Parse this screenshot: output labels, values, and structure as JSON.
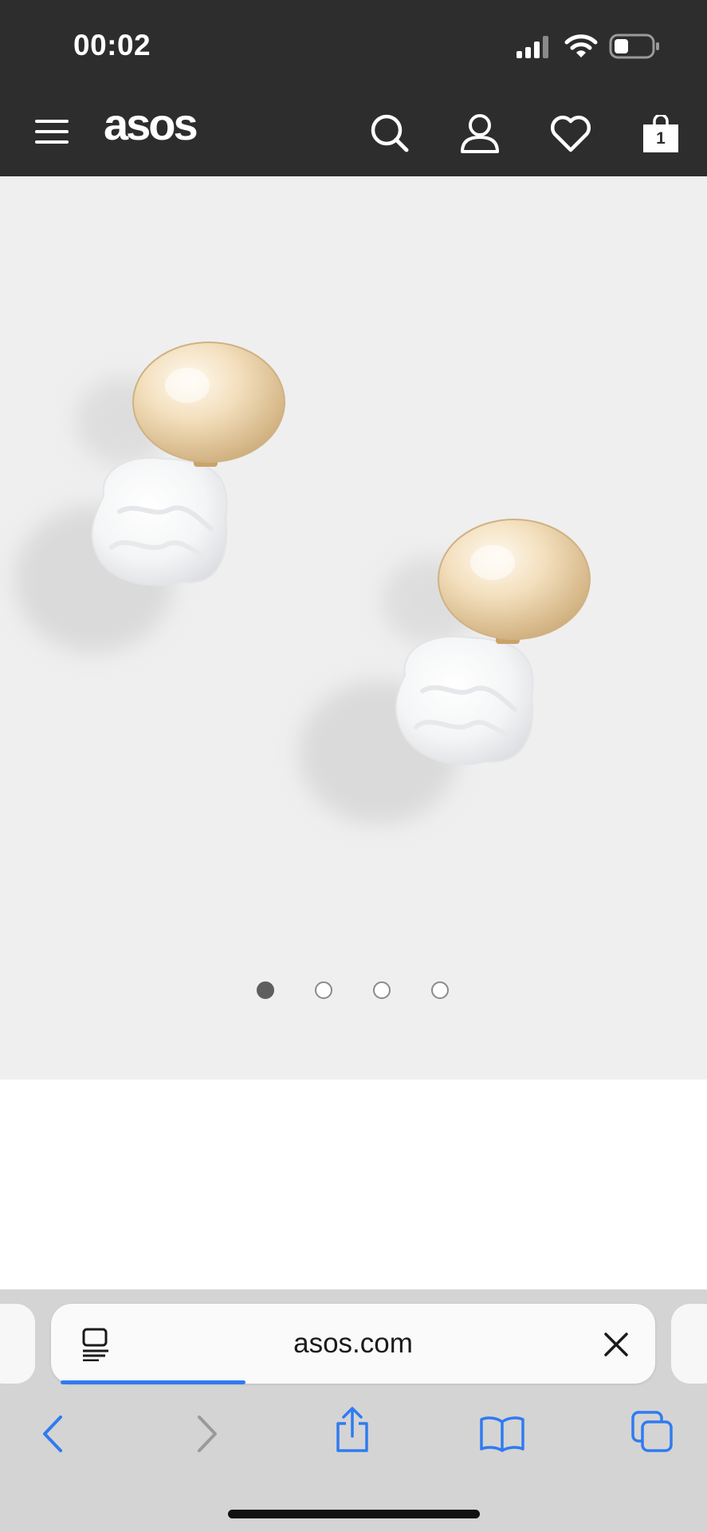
{
  "status_bar": {
    "time": "00:02",
    "battery_level": 0.35
  },
  "header": {
    "logo": "asos",
    "cart_count": "1",
    "icons": [
      "menu-icon",
      "search-icon",
      "account-icon",
      "heart-icon",
      "bag-icon"
    ]
  },
  "gallery": {
    "image_count": 4,
    "active_index": 0
  },
  "browser": {
    "url": "asos.com",
    "load_progress": 0.27,
    "icons": [
      "reader-icon",
      "close-icon",
      "back-icon",
      "forward-icon",
      "share-icon",
      "bookmarks-icon",
      "tabs-icon"
    ]
  },
  "colors": {
    "header_bg": "#2d2d2d",
    "accent_blue": "#2f7bf0",
    "hero_bg": "#efefef"
  }
}
